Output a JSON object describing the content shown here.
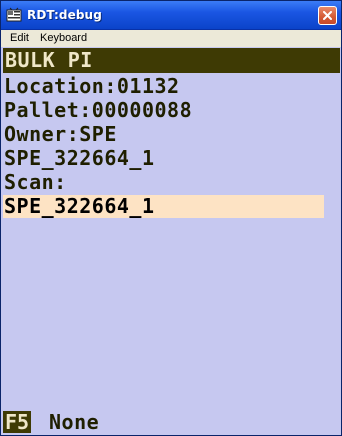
{
  "window": {
    "title": "RDT:debug",
    "close_icon": "close-icon",
    "app_icon": "rdt-app-icon"
  },
  "menu": {
    "items": [
      "Edit",
      "Keyboard"
    ]
  },
  "screen": {
    "header": "BULK PI",
    "lines": {
      "location": "Location:01132",
      "pallet": "Pallet:00000088",
      "owner": "Owner:SPE",
      "item": "SPE_322664_1",
      "scan_label": "Scan:"
    },
    "scan_field_value": "SPE_322664_1"
  },
  "footer": {
    "fkey": "F5",
    "fkey_label": "None"
  },
  "colors": {
    "background": "#c6c8f0",
    "header_bg": "#3e3a04",
    "header_text": "#efe7c8",
    "field_bg": "#fde3c4",
    "text": "#1f1f00"
  }
}
